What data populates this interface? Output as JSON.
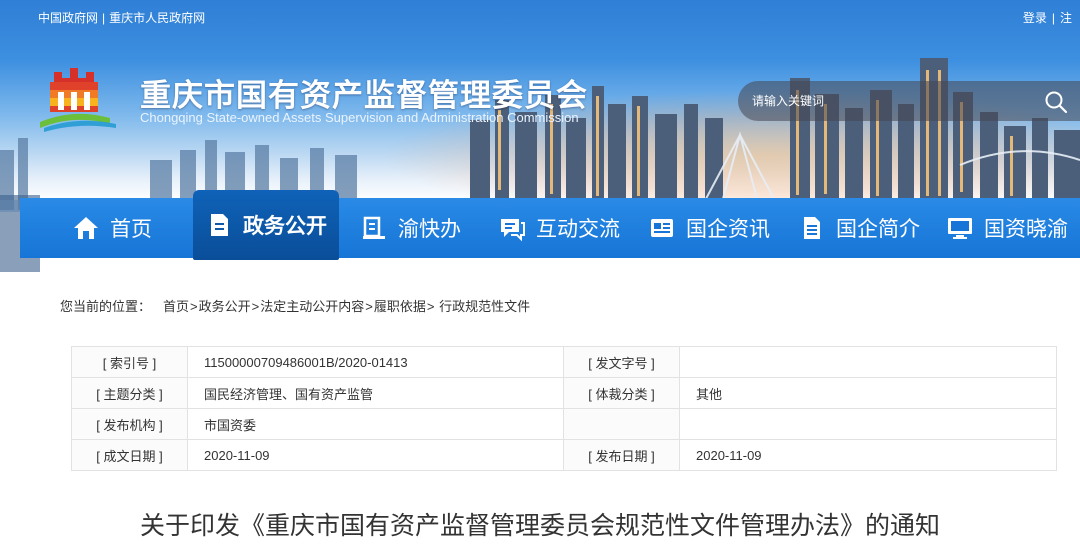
{
  "top_links": [
    "中国政府网",
    "重庆市人民政府网"
  ],
  "top_link_separator": "|",
  "account": {
    "login": "登录",
    "separator": "|",
    "register": "注"
  },
  "site": {
    "title": "重庆市国有资产监督管理委员会",
    "subtitle": "Chongqing State-owned Assets Supervision and Administration Commission"
  },
  "search": {
    "placeholder": "请输入关键词",
    "icon": "search-icon"
  },
  "nav": [
    {
      "label": "首页",
      "icon": "home-icon",
      "active": false
    },
    {
      "label": "政务公开",
      "icon": "document-icon",
      "active": true
    },
    {
      "label": "渝快办",
      "icon": "service-icon",
      "active": false
    },
    {
      "label": "互动交流",
      "icon": "chat-icon",
      "active": false
    },
    {
      "label": "国企资讯",
      "icon": "news-icon",
      "active": false
    },
    {
      "label": "国企简介",
      "icon": "file-icon",
      "active": false
    },
    {
      "label": "国资晓渝",
      "icon": "monitor-icon",
      "active": false
    }
  ],
  "breadcrumb": {
    "label": "您当前的位置：",
    "items": [
      "首页",
      "政务公开",
      "法定主动公开内容",
      "履职依据",
      " 行政规范性文件"
    ],
    "separator": ">"
  },
  "info_table": [
    {
      "k1": "[ 索引号 ]",
      "v1": "11500000709486001B/2020-01413",
      "k2": "[ 发文字号 ]",
      "v2": ""
    },
    {
      "k1": "[ 主题分类 ]",
      "v1": "国民经济管理、国有资产监管",
      "k2": "[ 体裁分类 ]",
      "v2": "其他"
    },
    {
      "k1": "[ 发布机构 ]",
      "v1": "市国资委",
      "k2": "",
      "v2": ""
    },
    {
      "k1": "[ 成文日期 ]",
      "v1": "2020-11-09",
      "k2": "[ 发布日期 ]",
      "v2": "2020-11-09"
    }
  ],
  "article": {
    "title": "关于印发《重庆市国有资产监督管理委员会规范性文件管理办法》的通知"
  },
  "colors": {
    "nav": "#1675d6",
    "nav_active": "#0a4e99",
    "text": "#333333"
  }
}
